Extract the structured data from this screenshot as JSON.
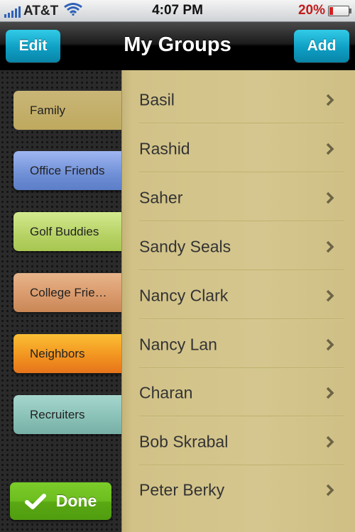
{
  "status_bar": {
    "carrier": "AT&T",
    "time": "4:07 PM",
    "battery_percent": "20%",
    "battery_level": 0.2,
    "signal_bars": 5
  },
  "nav": {
    "title": "My Groups",
    "edit_label": "Edit",
    "add_label": "Add"
  },
  "groups": [
    {
      "label": "Family",
      "active": true
    },
    {
      "label": "Office Friends"
    },
    {
      "label": "Golf Buddies"
    },
    {
      "label": "College Frie…"
    },
    {
      "label": "Neighbors"
    },
    {
      "label": "Recruiters"
    }
  ],
  "done_label": "Done",
  "members": [
    {
      "name": "Basil"
    },
    {
      "name": "Rashid"
    },
    {
      "name": "Saher"
    },
    {
      "name": "Sandy Seals"
    },
    {
      "name": "Nancy Clark"
    },
    {
      "name": "Nancy Lan"
    },
    {
      "name": "Charan"
    },
    {
      "name": "Bob Skrabal"
    },
    {
      "name": "Peter Berky"
    }
  ],
  "colors": {
    "accent_button": "#13a6cb",
    "done_green": "#6cbd1e",
    "battery_red": "#c21d1d",
    "panel_gold": "#d2c288"
  }
}
